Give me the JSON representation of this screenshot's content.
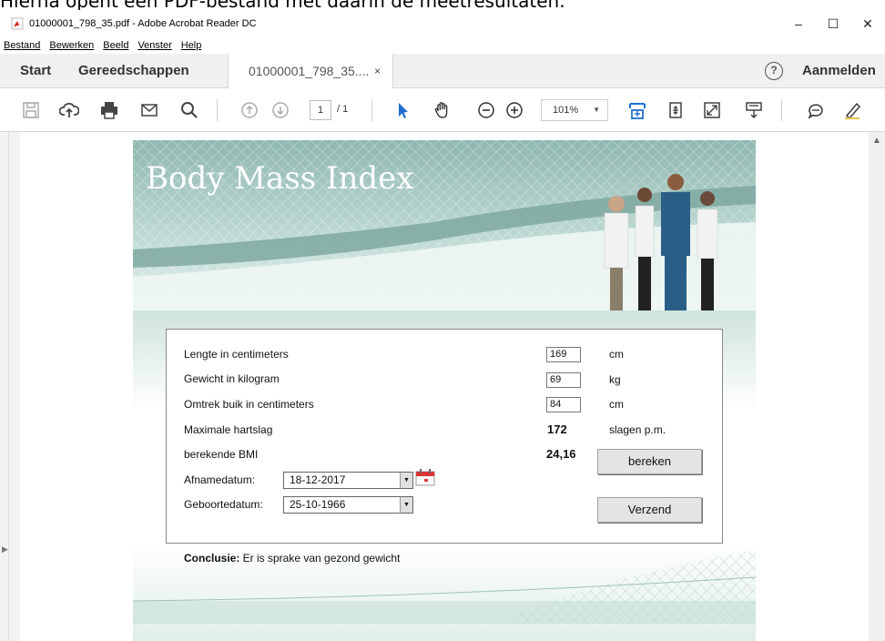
{
  "caption": "Hierna opent een PDF-bestand met daarin de meetresultaten.",
  "window": {
    "title": "01000001_798_35.pdf - Adobe Acrobat Reader DC",
    "minimize": "–",
    "maximize": "☐",
    "close": "✕"
  },
  "menu": [
    "Bestand",
    "Bewerken",
    "Beeld",
    "Venster",
    "Help"
  ],
  "tabs": {
    "start": "Start",
    "tools": "Gereedschappen",
    "document": "01000001_798_35....",
    "close": "×",
    "help": "?",
    "signin": "Aanmelden"
  },
  "toolbar": {
    "page_current": "1",
    "page_total": "/ 1",
    "zoom": "101%"
  },
  "pdf": {
    "banner_title": "Body Mass Index",
    "fields": {
      "length_label": "Lengte in centimeters",
      "length_value": "169",
      "length_unit": "cm",
      "weight_label": "Gewicht in kilogram",
      "weight_value": "69",
      "weight_unit": "kg",
      "waist_label": "Omtrek buik in centimeters",
      "waist_value": "84",
      "waist_unit": "cm",
      "hr_label": "Maximale hartslag",
      "hr_value": "172",
      "hr_unit": "slagen p.m.",
      "bmi_label": "berekende BMI",
      "bmi_value": "24,16",
      "date_label": "Afnamedatum:",
      "date_value": "18-12-2017",
      "birth_label": "Geboortedatum:",
      "birth_value": "25-10-1966"
    },
    "buttons": {
      "calculate": "bereken",
      "send": "Verzend"
    },
    "conclusion_label": "Conclusie:",
    "conclusion_text": " Er is sprake van gezond gewicht"
  },
  "colors": {
    "acrobat_red": "#d9261c",
    "accent_blue": "#1f6fd1",
    "banner_teal": "#8fb8b0"
  }
}
